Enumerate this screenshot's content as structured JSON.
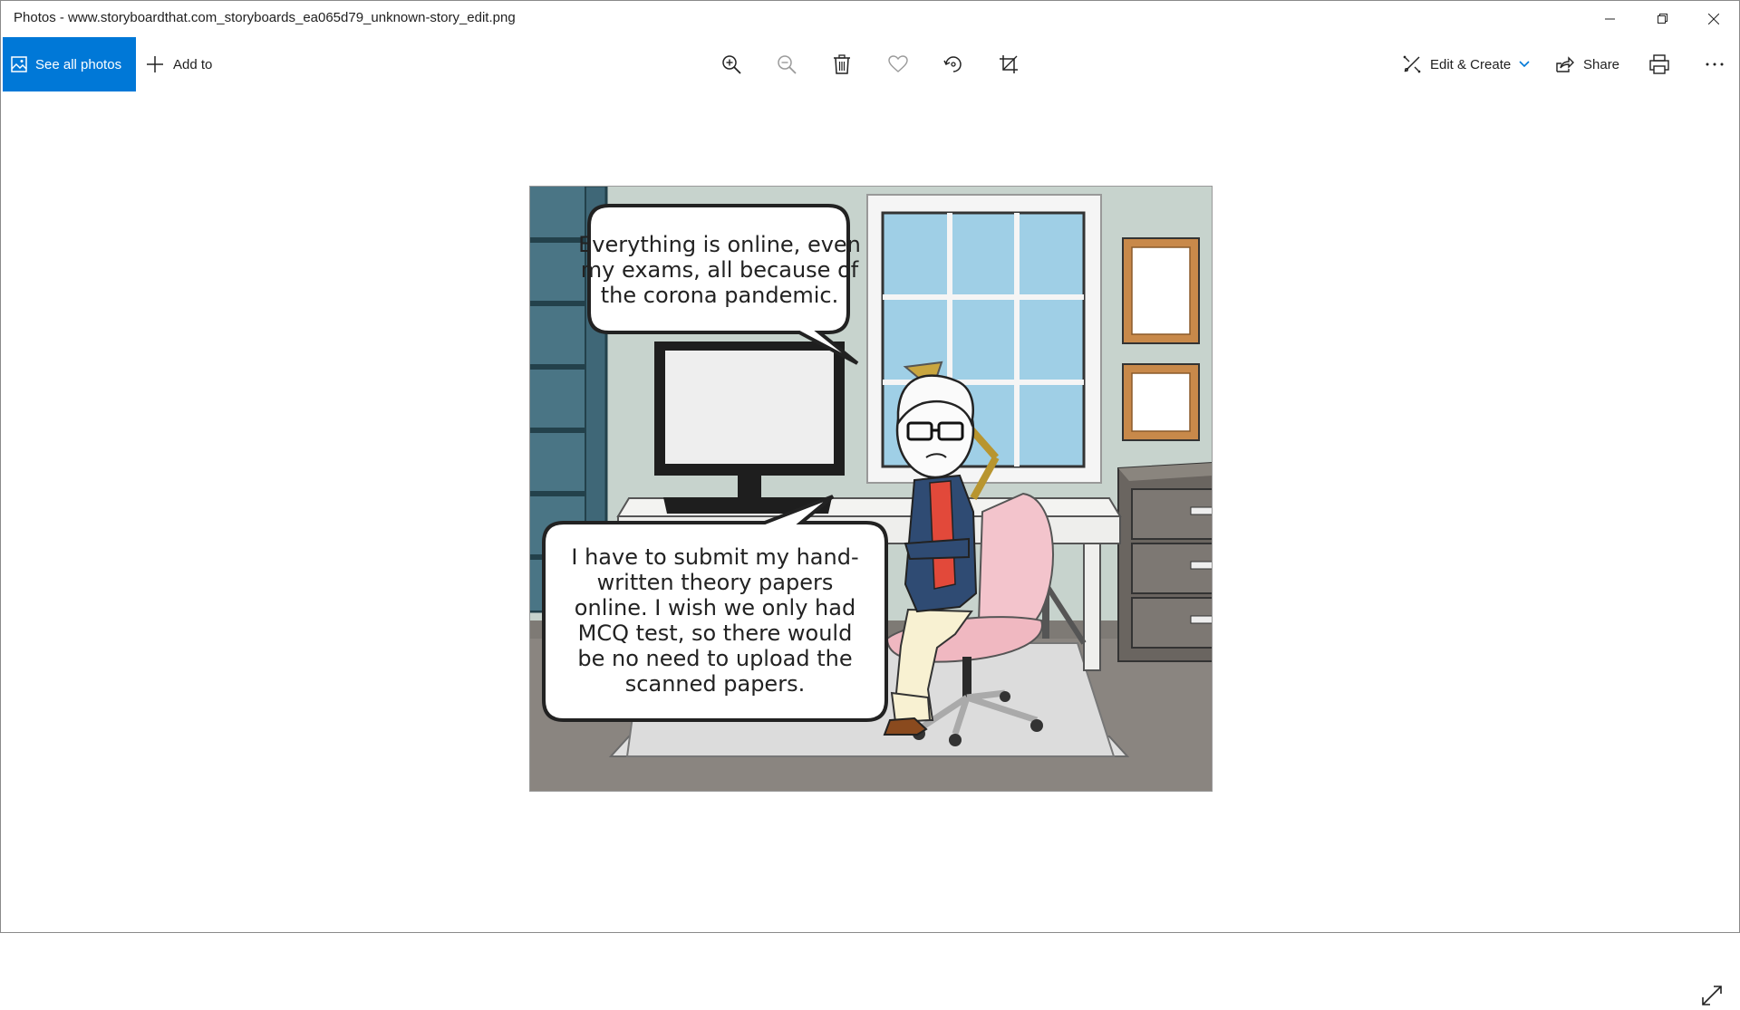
{
  "window": {
    "title": "Photos - www.storyboardthat.com_storyboards_ea065d79_unknown-story_edit.png"
  },
  "toolbar": {
    "see_all_photos": "See all photos",
    "add_to": "Add to",
    "edit_create": "Edit & Create",
    "share": "Share",
    "icons": [
      "zoom-in-icon",
      "zoom-out-icon",
      "delete-icon",
      "favorite-heart-icon",
      "rotate-icon",
      "crop-icon",
      "print-icon",
      "more-icon"
    ]
  },
  "comic": {
    "bubble_top": [
      "Everything is online, even",
      "my exams, all because of",
      "the corona pandemic."
    ],
    "bubble_bottom": [
      "I have to submit my hand-",
      "written theory papers",
      "online. I wish we only had",
      "MCQ test, so there would",
      "be no need to upload the",
      "scanned papers."
    ]
  },
  "colors": {
    "accent": "#0078d7",
    "wall": "#c7d3cd",
    "floor": "#8a8580",
    "window_glass": "#9fcfe6",
    "shelf": "#3f6777",
    "chair": "#f3c4cc"
  }
}
